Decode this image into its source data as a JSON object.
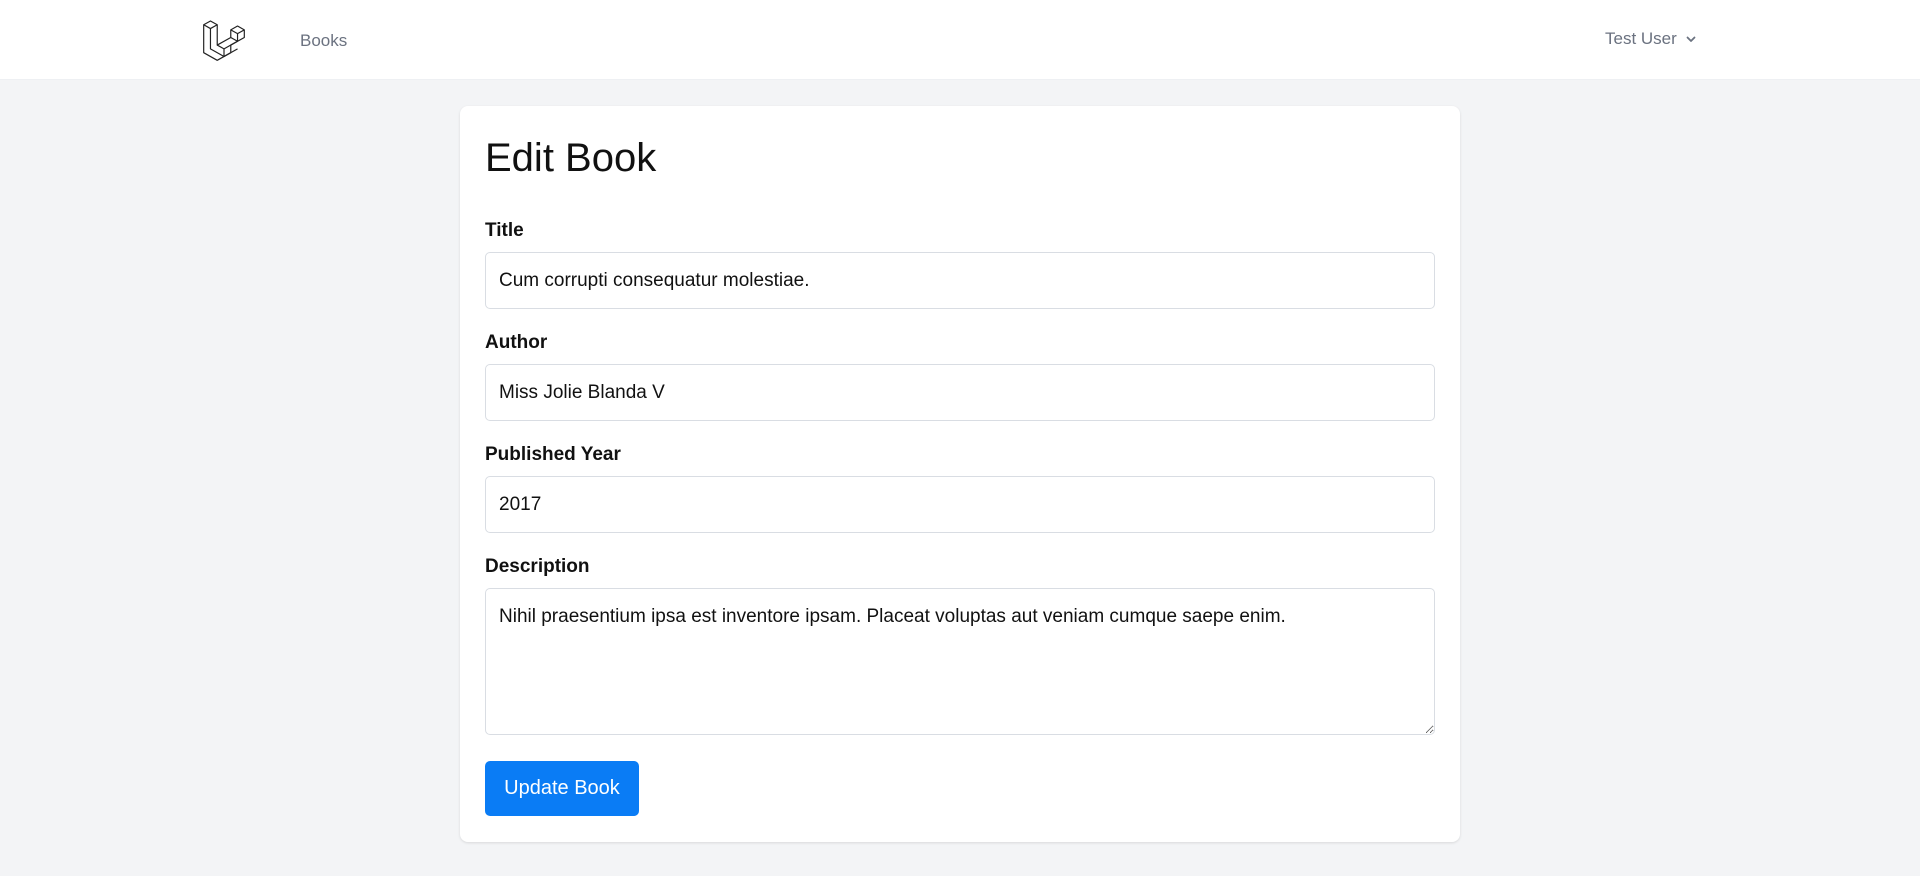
{
  "nav": {
    "logo_icon": "laravel-logo-icon",
    "books_link": "Books",
    "user_name": "Test User",
    "user_chevron_icon": "chevron-down-icon"
  },
  "form": {
    "title": "Edit Book",
    "fields": {
      "title": {
        "label": "Title",
        "value": "Cum corrupti consequatur molestiae."
      },
      "author": {
        "label": "Author",
        "value": "Miss Jolie Blanda V"
      },
      "published_year": {
        "label": "Published Year",
        "value": "2017"
      },
      "description": {
        "label": "Description",
        "value": "Nihil praesentium ipsa est inventore ipsam. Placeat voluptas aut veniam cumque saepe enim."
      }
    },
    "submit_label": "Update Book"
  },
  "colors": {
    "accent": "#0a7cf5",
    "background": "#f3f4f6",
    "card": "#ffffff"
  }
}
